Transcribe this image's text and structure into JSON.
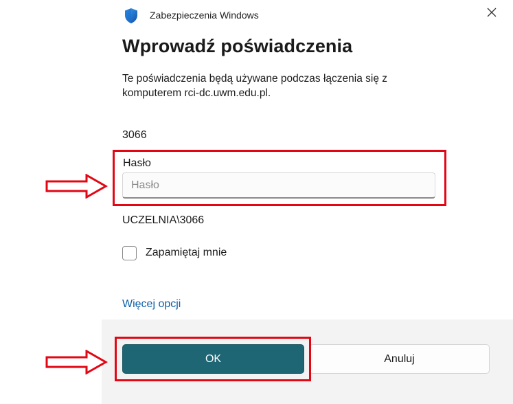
{
  "dialog": {
    "app_title": "Zabezpieczenia Windows",
    "title": "Wprowadź poświadczenia",
    "description": "Te poświadczenia będą używane podczas łączenia się z komputerem rci-dc.uwm.edu.pl.",
    "username": "3066",
    "password_label": "Hasło",
    "password_placeholder": "Hasło",
    "password_value": "",
    "domain_user": "UCZELNIA\\3066",
    "remember_label": "Zapamiętaj mnie",
    "remember_checked": false,
    "more_options": "Więcej opcji",
    "ok_label": "OK",
    "cancel_label": "Anuluj"
  },
  "icons": {
    "app": "shield-icon",
    "close": "close-icon",
    "annotation": "arrow-right-icon"
  },
  "colors": {
    "accent": "#1e6673",
    "link": "#0b5ea8",
    "annotation": "#e30613",
    "footer_bg": "#f3f3f3"
  }
}
